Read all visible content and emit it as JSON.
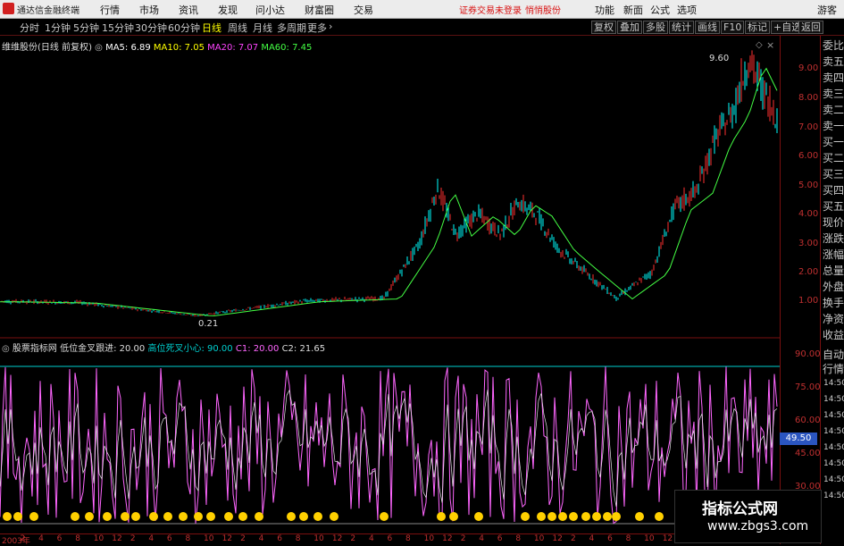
{
  "topbar": {
    "app_title": "通达信金融终端",
    "menu": [
      "行情",
      "市场",
      "资讯",
      "发现",
      "问小达",
      "财富圈",
      "交易"
    ],
    "warning": "证券交易未登录",
    "warning2": "悄悄股份",
    "right_menu": [
      "功能",
      "新面",
      "公式",
      "选项"
    ],
    "guest": "游客"
  },
  "toolbar": {
    "periods": [
      "分时",
      "1分钟",
      "5分钟",
      "15分钟",
      "30分钟",
      "60分钟",
      "日线",
      "周线",
      "月线",
      "多周期",
      "更多"
    ],
    "active_period": "日线",
    "right_buttons": [
      "复权",
      "叠加",
      "多股",
      "统计",
      "画线",
      "F10",
      "标记",
      "+自选",
      "返回"
    ]
  },
  "kline": {
    "title": "维维股份(日线 前复权)",
    "ma": [
      {
        "label": "MA5: 6.89",
        "color": "#ffffff"
      },
      {
        "label": "MA10: 7.05",
        "color": "#ffff00"
      },
      {
        "label": "MA20: 7.07",
        "color": "#ff44ff"
      },
      {
        "label": "MA60: 7.45",
        "color": "#44ff44"
      }
    ],
    "high_label": "9.60",
    "low_label": "0.21",
    "price_ticks": [
      "9.00",
      "8.00",
      "7.00",
      "6.00",
      "5.00",
      "4.00",
      "3.00",
      "2.00",
      "1.00"
    ]
  },
  "oscillator": {
    "name": "股票指标网",
    "params": [
      {
        "label": "低位金叉跟进: 20.00",
        "color": "#dddddd"
      },
      {
        "label": "高位死叉小心: 90.00",
        "color": "#00d0d0"
      },
      {
        "label": "C1: 20.00",
        "color": "#ff66ff"
      },
      {
        "label": "C2: 21.65",
        "color": "#dddddd"
      }
    ],
    "ticks": [
      "90.00",
      "75.00",
      "60.00",
      "45.00",
      "30.00"
    ],
    "current_value": "49.50"
  },
  "side_panel": {
    "labels": [
      "委比",
      "卖五",
      "卖四",
      "卖三",
      "卖二",
      "卖一",
      "买一",
      "买二",
      "买三",
      "买四",
      "买五",
      "现价",
      "涨跌",
      "涨幅",
      "总量",
      "外盘",
      "换手",
      "净资",
      "收益"
    ],
    "lower_labels": [
      "自动",
      "行情"
    ],
    "times": [
      "14:50",
      "14:50",
      "14:50",
      "14:50",
      "14:50",
      "14:50",
      "14:50",
      "14:50"
    ]
  },
  "xaxis": {
    "labels": [
      "2003年",
      "2",
      "4",
      "6",
      "8",
      "10",
      "12",
      "2",
      "4",
      "6",
      "8",
      "10",
      "12",
      "2",
      "4",
      "6",
      "8",
      "10",
      "12",
      "2",
      "4",
      "6",
      "8",
      "10",
      "12",
      "2",
      "4",
      "6",
      "8",
      "10",
      "12",
      "2",
      "4",
      "6",
      "8",
      "10",
      "12",
      "2",
      "4",
      "6",
      "8",
      "10"
    ]
  },
  "watermark": {
    "line1": "指标公式网",
    "line2": "www.zbgs3.com"
  },
  "colors": {
    "up": "#ff3030",
    "down": "#00ffff",
    "osc_line": "#ff66ff",
    "osc_line2": "#e8e8e8",
    "axis": "#c03030",
    "ma60": "#44ff44",
    "ref_line": "#00d0d0",
    "smiley": "#ffd000"
  }
}
